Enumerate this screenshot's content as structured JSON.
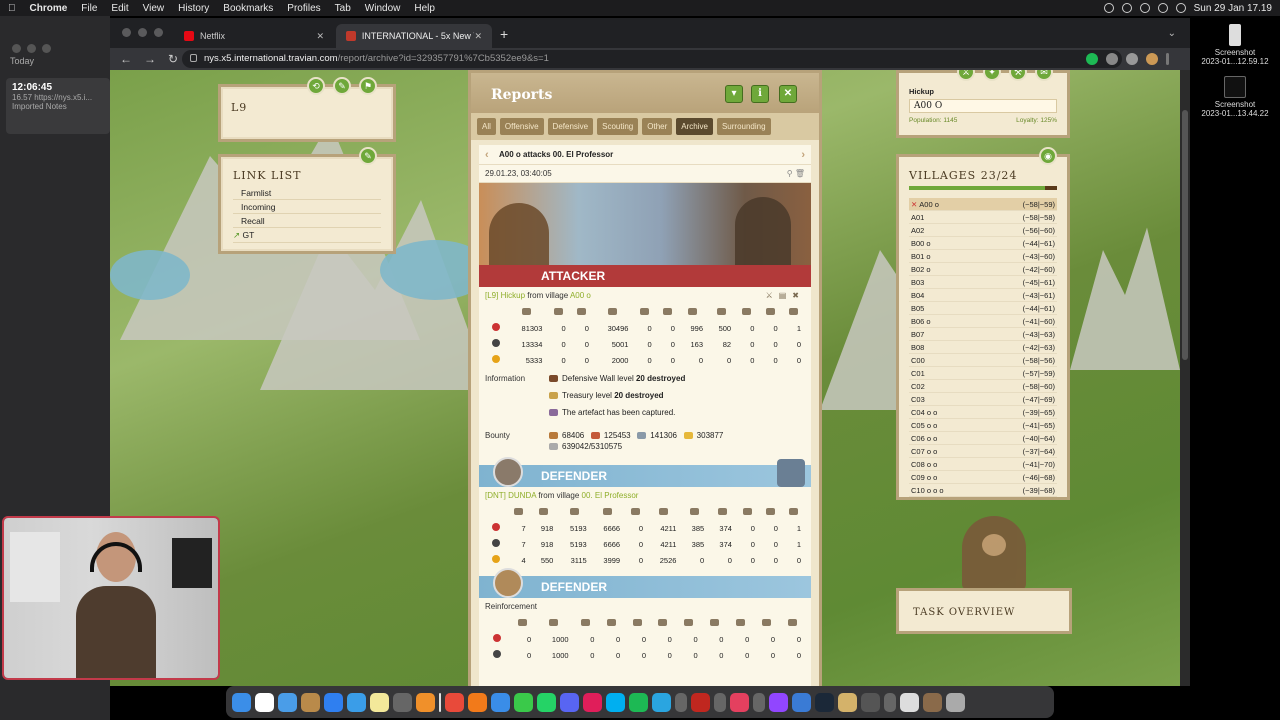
{
  "menubar": {
    "app": "Chrome",
    "items": [
      "File",
      "Edit",
      "View",
      "History",
      "Bookmarks",
      "Profiles",
      "Tab",
      "Window",
      "Help"
    ],
    "clock": "Sun 29 Jan  17.19"
  },
  "notes": {
    "today": "Today",
    "time": "12:06:45",
    "subtime": "16.57",
    "url": "https://nys.x5.i...",
    "folder": "Imported Notes"
  },
  "screenshots": [
    {
      "label": "Screenshot",
      "date": "2023-01...12.59.12"
    },
    {
      "label": "Screenshot",
      "date": "2023-01...13.44.22"
    }
  ],
  "browser": {
    "tabs": [
      {
        "title": "Netflix",
        "icon_color": "#e50914"
      },
      {
        "title": "INTERNATIONAL - 5x New Yea",
        "icon_color": "#c0392b"
      }
    ],
    "url_host": "nys.x5.international.travian.com",
    "url_path": "/report/archive?id=329357791%7Cb5352ee9&s=1"
  },
  "l9": {
    "title": "L9"
  },
  "linklist": {
    "title": "LINK LIST",
    "items": [
      "Farmlist",
      "Incoming",
      "Recall",
      "GT"
    ]
  },
  "reports": {
    "title": "Reports",
    "filters": [
      "All",
      "Offensive",
      "Defensive",
      "Scouting",
      "Other",
      "Archive",
      "Surrounding"
    ],
    "active_filter": "Archive",
    "subject": "A00 o attacks 00. El Professor",
    "date": "29.01.23, 03:40:05",
    "attacker_label": "ATTACKER",
    "attacker_line": {
      "tag": "[L9]",
      "player": "Hickup",
      "from": "from village",
      "village": "A00 o"
    },
    "attacker_rows": [
      [
        "81303",
        "0",
        "0",
        "30496",
        "0",
        "0",
        "996",
        "500",
        "0",
        "0",
        "1"
      ],
      [
        "13334",
        "0",
        "0",
        "5001",
        "0",
        "0",
        "163",
        "82",
        "0",
        "0",
        "0"
      ],
      [
        "5333",
        "0",
        "0",
        "2000",
        "0",
        "0",
        "0",
        "0",
        "0",
        "0",
        "0"
      ]
    ],
    "information_label": "Information",
    "info_lines": [
      {
        "text": "Defensive Wall level",
        "bold": "20 destroyed"
      },
      {
        "text": "Treasury level",
        "bold": "20 destroyed"
      },
      {
        "text": "The artefact has been captured.",
        "bold": ""
      }
    ],
    "bounty_label": "Bounty",
    "bounty": [
      "68406",
      "125453",
      "141306",
      "303877"
    ],
    "bounty_total": "639042/5310575",
    "defender_label": "DEFENDER",
    "defender_line": {
      "tag": "[DNT]",
      "player": "DUNDA",
      "from": "from village",
      "village": "00. El Professor"
    },
    "defender_rows": [
      [
        "7",
        "918",
        "5193",
        "6666",
        "0",
        "4211",
        "385",
        "374",
        "0",
        "0",
        "1"
      ],
      [
        "7",
        "918",
        "5193",
        "6666",
        "0",
        "4211",
        "385",
        "374",
        "0",
        "0",
        "1"
      ],
      [
        "4",
        "550",
        "3115",
        "3999",
        "0",
        "2526",
        "0",
        "0",
        "0",
        "0",
        "0"
      ]
    ],
    "defender2_label": "DEFENDER",
    "reinforcement_label": "Reinforcement",
    "reinforcement_rows": [
      [
        "0",
        "1000",
        "0",
        "0",
        "0",
        "0",
        "0",
        "0",
        "0",
        "0",
        "0"
      ],
      [
        "0",
        "1000",
        "0",
        "0",
        "0",
        "0",
        "0",
        "0",
        "0",
        "0",
        "0"
      ]
    ]
  },
  "hickup": {
    "player": "Hickup",
    "village": "A00 O",
    "population": "Population: 1145",
    "loyalty": "Loyalty: 125%"
  },
  "villages": {
    "title": "VILLAGES 23/24",
    "list": [
      {
        "name": "A00 o",
        "coords": "(−58|−59)",
        "selected": true
      },
      {
        "name": "A01",
        "coords": "(−58|−58)"
      },
      {
        "name": "A02",
        "coords": "(−56|−60)"
      },
      {
        "name": "B00 o",
        "coords": "(−44|−61)"
      },
      {
        "name": "B01 o",
        "coords": "(−43|−60)"
      },
      {
        "name": "B02 o",
        "coords": "(−42|−60)"
      },
      {
        "name": "B03",
        "coords": "(−45|−61)"
      },
      {
        "name": "B04",
        "coords": "(−43|−61)"
      },
      {
        "name": "B05",
        "coords": "(−44|−61)"
      },
      {
        "name": "B06 o",
        "coords": "(−41|−60)"
      },
      {
        "name": "B07",
        "coords": "(−43|−63)"
      },
      {
        "name": "B08",
        "coords": "(−42|−63)"
      },
      {
        "name": "C00",
        "coords": "(−58|−56)"
      },
      {
        "name": "C01",
        "coords": "(−57|−59)"
      },
      {
        "name": "C02",
        "coords": "(−58|−60)"
      },
      {
        "name": "C03",
        "coords": "(−47|−69)"
      },
      {
        "name": "C04 o o",
        "coords": "(−39|−65)"
      },
      {
        "name": "C05 o o",
        "coords": "(−41|−65)"
      },
      {
        "name": "C06 o o",
        "coords": "(−40|−64)"
      },
      {
        "name": "C07 o o",
        "coords": "(−37|−64)"
      },
      {
        "name": "C08 o o",
        "coords": "(−41|−70)"
      },
      {
        "name": "C09 o o",
        "coords": "(−46|−68)"
      },
      {
        "name": "C10 o o o",
        "coords": "(−39|−68)"
      }
    ]
  },
  "task": {
    "title": "TASK OVERVIEW"
  },
  "colors": {
    "accent_green": "#6fa83a",
    "attacker_red": "#b23a3a",
    "defender_blue": "#7fb3d0"
  }
}
